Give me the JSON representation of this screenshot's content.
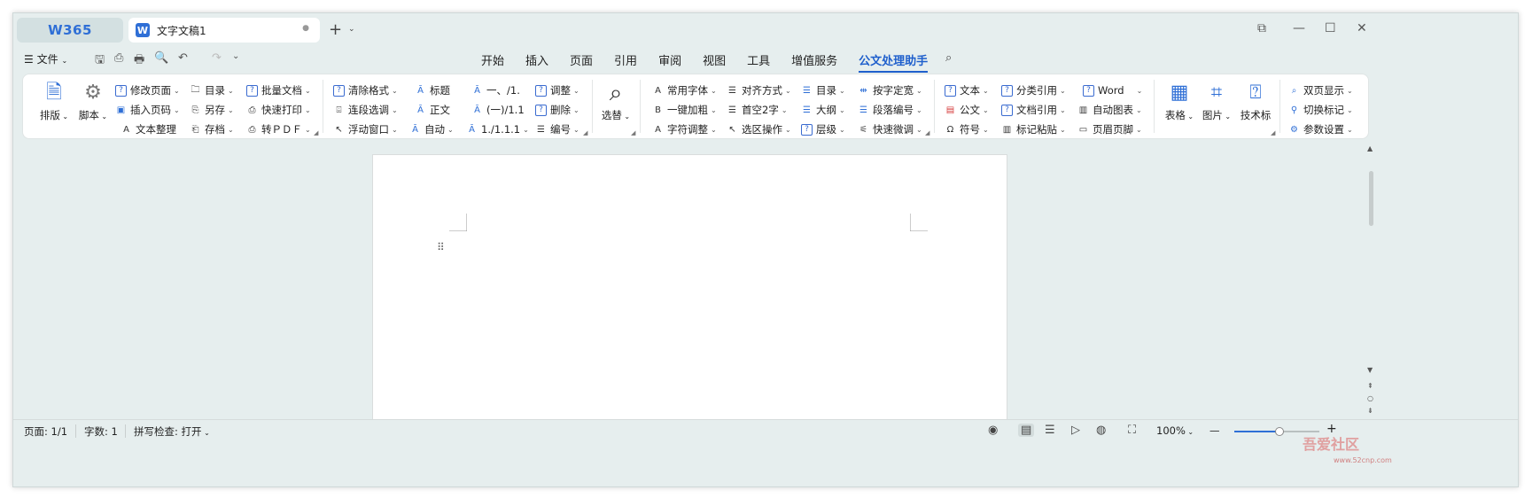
{
  "titlebar": {
    "brand": "W365",
    "doc_tab_title": "文字文稿1",
    "doc_tab_badge": "W",
    "unsaved_dot": "●",
    "new_tab": "+",
    "new_tab_caret": "⌄",
    "window_buttons": [
      "⧉",
      "—",
      "☐",
      "✕"
    ]
  },
  "menu": {
    "file_label": "文件",
    "file_icon": "☰",
    "quick_access": [
      "🖫",
      "⎙",
      "🖶",
      "🔍",
      "↶",
      "↷",
      "⌄"
    ],
    "tabs": [
      "开始",
      "插入",
      "页面",
      "引用",
      "审阅",
      "视图",
      "工具",
      "增值服务",
      "公文处理助手"
    ],
    "active_tab": "公文处理助手"
  },
  "ribbon": {
    "g1": {
      "big1": "排版",
      "big2": "脚本",
      "col1": [
        "修改页面",
        "插入页码",
        "文本整理"
      ],
      "col2": [
        "目录",
        "另存",
        "存档"
      ],
      "col3": [
        "批量文档",
        "快速打印",
        "转ＰＤＦ"
      ]
    },
    "g2": {
      "col1": [
        "清除格式",
        "连段选调",
        "浮动窗口"
      ],
      "col2": [
        "标题",
        "正文",
        "自动"
      ],
      "col3": [
        "一、/1.",
        "(一)/1.1",
        "1./1.1.1"
      ],
      "col4": [
        "调整",
        "删除",
        "编号"
      ]
    },
    "g3": {
      "big": "选替"
    },
    "g4": {
      "col1": [
        "常用字体",
        "一键加粗",
        "字符调整"
      ],
      "col2": [
        "对齐方式",
        "首空2字",
        "选区操作"
      ],
      "col3": [
        "目录",
        "大纲",
        "层级"
      ],
      "col4": [
        "按字定宽",
        "段落编号",
        "快速微调"
      ]
    },
    "g5": {
      "col1": [
        "文本",
        "公文",
        "符号"
      ],
      "col2": [
        "分类引用",
        "文档引用",
        "标记粘贴"
      ],
      "col3": [
        "Word",
        "自动图表",
        "页眉页脚"
      ]
    },
    "g6": {
      "big1": "表格",
      "big2": "图片",
      "big3": "技术标"
    },
    "g7": {
      "col1": [
        "双页显示",
        "切换标记",
        "参数设置"
      ]
    }
  },
  "statusbar": {
    "page": "页面: 1/1",
    "words": "字数: 1",
    "spell": "拼写检查: 打开",
    "zoom": "100%",
    "zoom_minus": "—",
    "zoom_plus": "+"
  },
  "watermark": {
    "text": "吾爱社区",
    "url": "www.52cnp.com"
  },
  "colors": {
    "accent": "#1f5fcc",
    "window_bg": "#e6eeee",
    "ribbon_bg": "#ffffff"
  }
}
